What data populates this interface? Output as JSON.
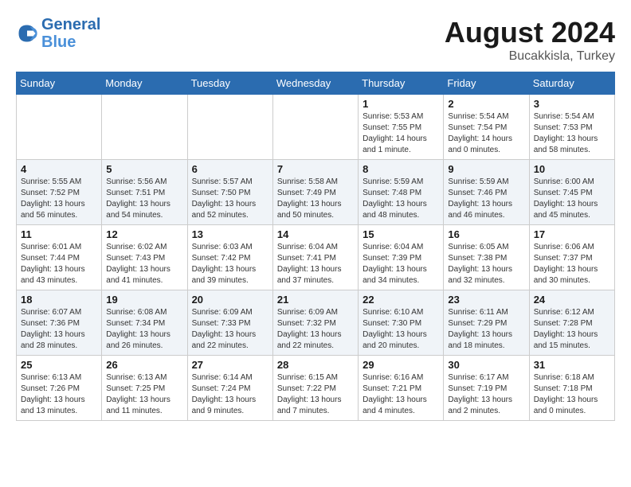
{
  "header": {
    "logo_line1": "General",
    "logo_line2": "Blue",
    "month_year": "August 2024",
    "location": "Bucakkisla, Turkey"
  },
  "weekdays": [
    "Sunday",
    "Monday",
    "Tuesday",
    "Wednesday",
    "Thursday",
    "Friday",
    "Saturday"
  ],
  "weeks": [
    [
      {
        "day": "",
        "info": ""
      },
      {
        "day": "",
        "info": ""
      },
      {
        "day": "",
        "info": ""
      },
      {
        "day": "",
        "info": ""
      },
      {
        "day": "1",
        "info": "Sunrise: 5:53 AM\nSunset: 7:55 PM\nDaylight: 14 hours\nand 1 minute."
      },
      {
        "day": "2",
        "info": "Sunrise: 5:54 AM\nSunset: 7:54 PM\nDaylight: 14 hours\nand 0 minutes."
      },
      {
        "day": "3",
        "info": "Sunrise: 5:54 AM\nSunset: 7:53 PM\nDaylight: 13 hours\nand 58 minutes."
      }
    ],
    [
      {
        "day": "4",
        "info": "Sunrise: 5:55 AM\nSunset: 7:52 PM\nDaylight: 13 hours\nand 56 minutes."
      },
      {
        "day": "5",
        "info": "Sunrise: 5:56 AM\nSunset: 7:51 PM\nDaylight: 13 hours\nand 54 minutes."
      },
      {
        "day": "6",
        "info": "Sunrise: 5:57 AM\nSunset: 7:50 PM\nDaylight: 13 hours\nand 52 minutes."
      },
      {
        "day": "7",
        "info": "Sunrise: 5:58 AM\nSunset: 7:49 PM\nDaylight: 13 hours\nand 50 minutes."
      },
      {
        "day": "8",
        "info": "Sunrise: 5:59 AM\nSunset: 7:48 PM\nDaylight: 13 hours\nand 48 minutes."
      },
      {
        "day": "9",
        "info": "Sunrise: 5:59 AM\nSunset: 7:46 PM\nDaylight: 13 hours\nand 46 minutes."
      },
      {
        "day": "10",
        "info": "Sunrise: 6:00 AM\nSunset: 7:45 PM\nDaylight: 13 hours\nand 45 minutes."
      }
    ],
    [
      {
        "day": "11",
        "info": "Sunrise: 6:01 AM\nSunset: 7:44 PM\nDaylight: 13 hours\nand 43 minutes."
      },
      {
        "day": "12",
        "info": "Sunrise: 6:02 AM\nSunset: 7:43 PM\nDaylight: 13 hours\nand 41 minutes."
      },
      {
        "day": "13",
        "info": "Sunrise: 6:03 AM\nSunset: 7:42 PM\nDaylight: 13 hours\nand 39 minutes."
      },
      {
        "day": "14",
        "info": "Sunrise: 6:04 AM\nSunset: 7:41 PM\nDaylight: 13 hours\nand 37 minutes."
      },
      {
        "day": "15",
        "info": "Sunrise: 6:04 AM\nSunset: 7:39 PM\nDaylight: 13 hours\nand 34 minutes."
      },
      {
        "day": "16",
        "info": "Sunrise: 6:05 AM\nSunset: 7:38 PM\nDaylight: 13 hours\nand 32 minutes."
      },
      {
        "day": "17",
        "info": "Sunrise: 6:06 AM\nSunset: 7:37 PM\nDaylight: 13 hours\nand 30 minutes."
      }
    ],
    [
      {
        "day": "18",
        "info": "Sunrise: 6:07 AM\nSunset: 7:36 PM\nDaylight: 13 hours\nand 28 minutes."
      },
      {
        "day": "19",
        "info": "Sunrise: 6:08 AM\nSunset: 7:34 PM\nDaylight: 13 hours\nand 26 minutes."
      },
      {
        "day": "20",
        "info": "Sunrise: 6:09 AM\nSunset: 7:33 PM\nDaylight: 13 hours\nand 22 minutes."
      },
      {
        "day": "21",
        "info": "Sunrise: 6:09 AM\nSunset: 7:32 PM\nDaylight: 13 hours\nand 22 minutes."
      },
      {
        "day": "22",
        "info": "Sunrise: 6:10 AM\nSunset: 7:30 PM\nDaylight: 13 hours\nand 20 minutes."
      },
      {
        "day": "23",
        "info": "Sunrise: 6:11 AM\nSunset: 7:29 PM\nDaylight: 13 hours\nand 18 minutes."
      },
      {
        "day": "24",
        "info": "Sunrise: 6:12 AM\nSunset: 7:28 PM\nDaylight: 13 hours\nand 15 minutes."
      }
    ],
    [
      {
        "day": "25",
        "info": "Sunrise: 6:13 AM\nSunset: 7:26 PM\nDaylight: 13 hours\nand 13 minutes."
      },
      {
        "day": "26",
        "info": "Sunrise: 6:13 AM\nSunset: 7:25 PM\nDaylight: 13 hours\nand 11 minutes."
      },
      {
        "day": "27",
        "info": "Sunrise: 6:14 AM\nSunset: 7:24 PM\nDaylight: 13 hours\nand 9 minutes."
      },
      {
        "day": "28",
        "info": "Sunrise: 6:15 AM\nSunset: 7:22 PM\nDaylight: 13 hours\nand 7 minutes."
      },
      {
        "day": "29",
        "info": "Sunrise: 6:16 AM\nSunset: 7:21 PM\nDaylight: 13 hours\nand 4 minutes."
      },
      {
        "day": "30",
        "info": "Sunrise: 6:17 AM\nSunset: 7:19 PM\nDaylight: 13 hours\nand 2 minutes."
      },
      {
        "day": "31",
        "info": "Sunrise: 6:18 AM\nSunset: 7:18 PM\nDaylight: 13 hours\nand 0 minutes."
      }
    ]
  ]
}
